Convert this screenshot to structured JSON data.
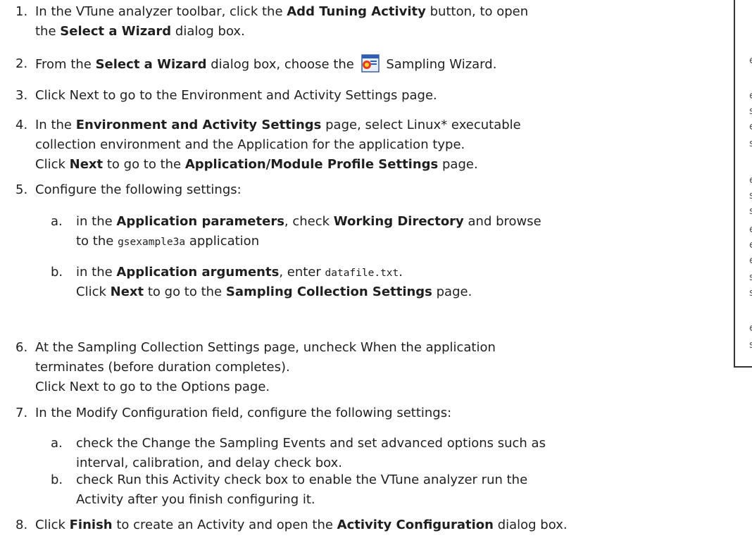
{
  "steps": [
    {
      "num": "1.",
      "parts": [
        {
          "t": "In the VTune analyzer toolbar, click the "
        },
        {
          "b": "Add Tuning Activity"
        },
        {
          "t": " button, to open"
        }
      ],
      "line2": [
        {
          "t": "the "
        },
        {
          "b": "Select a Wizard"
        },
        {
          "t": " dialog box."
        }
      ]
    },
    {
      "num": "2.",
      "parts": [
        {
          "t": "From the "
        },
        {
          "b": "Select a Wizard"
        },
        {
          "t": " dialog box, choose the "
        },
        {
          "icon": "sampling-wizard-icon"
        },
        {
          "t": " Sampling Wizard."
        }
      ]
    },
    {
      "num": "3.",
      "parts": [
        {
          "t": "Click Next to go to the Environment and Activity Settings page."
        }
      ]
    },
    {
      "num": "4.",
      "parts": [
        {
          "t": "In the "
        },
        {
          "b": "Environment and Activity Settings"
        },
        {
          "t": " page, select Linux* executable"
        }
      ],
      "line2": [
        {
          "t": "collection environment and the Application for the application type."
        }
      ],
      "line3": [
        {
          "t": "Click "
        },
        {
          "b": "Next"
        },
        {
          "t": " to go to the "
        },
        {
          "b": "Application/Module Profile Settings"
        },
        {
          "t": " page."
        }
      ]
    },
    {
      "num": "5.",
      "parts": [
        {
          "t": "Configure the following settings:"
        }
      ]
    },
    {
      "num": "6.",
      "parts": [
        {
          "t": "At the Sampling Collection Settings page, uncheck When the application"
        }
      ],
      "line2": [
        {
          "t": "terminates (before duration completes)."
        }
      ],
      "line3": [
        {
          "t": "Click Next to go to the Options page."
        }
      ]
    },
    {
      "num": "7.",
      "parts": [
        {
          "t": "In the Modify Configuration field, configure the following settings:"
        }
      ]
    },
    {
      "num": "8.",
      "parts": [
        {
          "t": "Click "
        },
        {
          "b": "Finish"
        },
        {
          "t": " to create an Activity and open the "
        },
        {
          "b": "Activity Configuration"
        },
        {
          "t": " dialog box."
        }
      ]
    }
  ],
  "substeps5": [
    {
      "let": "a.",
      "parts": [
        {
          "t": "in the "
        },
        {
          "b": "Application parameters"
        },
        {
          "t": ", check "
        },
        {
          "b": "Working Directory"
        },
        {
          "t": " and browse"
        }
      ],
      "line2": [
        {
          "t": "to the "
        },
        {
          "c": "gsexample3a"
        },
        {
          "t": " application"
        }
      ]
    },
    {
      "let": "b.",
      "parts": [
        {
          "t": "in the "
        },
        {
          "b": "Application arguments"
        },
        {
          "t": ", enter "
        },
        {
          "c": "datafile.txt"
        },
        {
          "t": "."
        }
      ],
      "line2": [
        {
          "t": "Click "
        },
        {
          "b": "Next"
        },
        {
          "t": " to go to the "
        },
        {
          "b": "Sampling Collection Settings"
        },
        {
          "t": " page."
        }
      ]
    }
  ],
  "substeps7": [
    {
      "let": "a.",
      "parts": [
        {
          "t": "check the Change the Sampling Events and set advanced options such as"
        }
      ],
      "line2": [
        {
          "t": "interval, calibration, and delay check box."
        }
      ]
    },
    {
      "let": "b.",
      "parts": [
        {
          "t": "check Run this Activity check box to enable the VTune analyzer run the"
        }
      ],
      "line2": [
        {
          "t": "Activity after you finish configuring it."
        }
      ]
    }
  ],
  "sidebar_fragments": [
    "e",
    "e",
    "s",
    "e",
    "s",
    "e",
    "s",
    "s",
    "e",
    "e",
    "e",
    "s",
    "s",
    "e",
    "s"
  ],
  "icons": {
    "sampling_wizard": "sampling-wizard-icon"
  }
}
